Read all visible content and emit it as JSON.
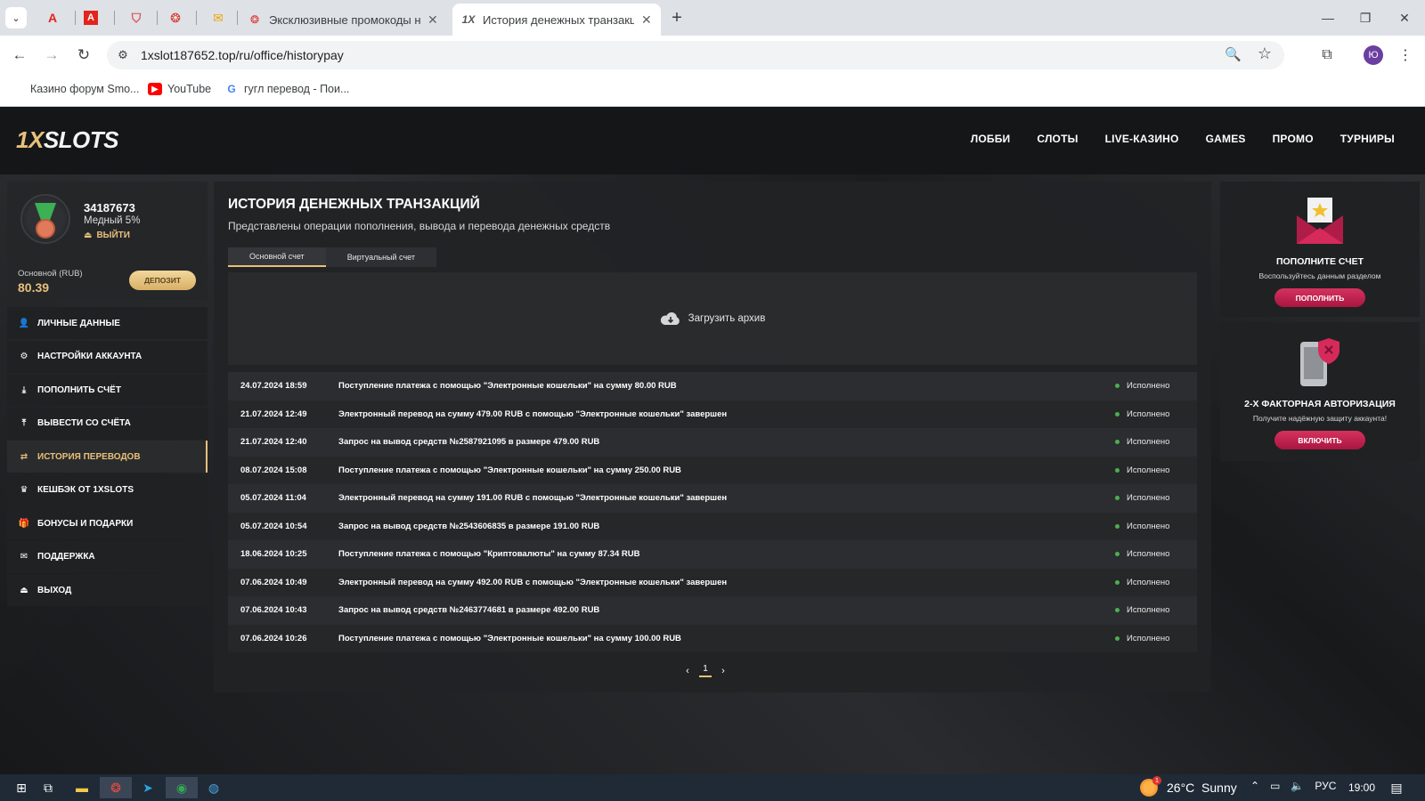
{
  "browser": {
    "pinned_tabs": [
      {
        "icon": "acrobat-icon",
        "glyph": "A",
        "color": "#e1251b"
      },
      {
        "icon": "pdf-icon",
        "glyph": "A",
        "color": "#e1251b"
      },
      {
        "icon": "shield-icon",
        "glyph": "⛉",
        "color": "#d9534f"
      },
      {
        "icon": "casino-icon",
        "glyph": "❂",
        "color": "#d9342b"
      },
      {
        "icon": "mail-icon",
        "glyph": "✉",
        "color": "#f0a500"
      }
    ],
    "tabs": [
      {
        "title": "Эксклюзивные промокоды на",
        "active": false
      },
      {
        "title": "История денежных транзакци",
        "active": true
      }
    ],
    "url": "1xslot187652.top/ru/office/historypay",
    "profile_initial": "Ю",
    "bookmarks": [
      {
        "label": "Казино форум Smo..."
      },
      {
        "label": "YouTube"
      },
      {
        "label": "гугл перевод - Пои..."
      }
    ]
  },
  "site": {
    "logo": {
      "accent": "1X",
      "rest": "SLOTS"
    },
    "nav": [
      "ЛОББИ",
      "СЛОТЫ",
      "LIVE-КАЗИНО",
      "GAMES",
      "ПРОМО",
      "ТУРНИРЫ"
    ],
    "user": {
      "id": "34187673",
      "rank": "Медный 5%",
      "logout": "ВЫЙТИ",
      "balance_label": "Основной (RUB)",
      "balance": "80.39",
      "deposit_label": "ДЕПОЗИТ"
    },
    "side_menu": [
      {
        "label": "ЛИЧНЫЕ ДАННЫЕ",
        "icon": "user-icon",
        "glyph": "👤",
        "active": false
      },
      {
        "label": "НАСТРОЙКИ АККАУНТА",
        "icon": "settings-icon",
        "glyph": "⚙",
        "active": false
      },
      {
        "label": "ПОПОЛНИТЬ СЧЁТ",
        "icon": "download-icon",
        "glyph": "⤓",
        "active": false
      },
      {
        "label": "ВЫВЕСТИ СО СЧЁТА",
        "icon": "withdraw-icon",
        "glyph": "⤒",
        "active": false
      },
      {
        "label": "ИСТОРИЯ ПЕРЕВОДОВ",
        "icon": "transfer-icon",
        "glyph": "⇄",
        "active": true
      },
      {
        "label": "КЕШБЭК ОТ 1XSLOTS",
        "icon": "crown-icon",
        "glyph": "♛",
        "active": false
      },
      {
        "label": "БОНУСЫ И ПОДАРКИ",
        "icon": "gift-icon",
        "glyph": "🎁",
        "active": false
      },
      {
        "label": "ПОДДЕРЖКА",
        "icon": "envelope-icon",
        "glyph": "✉",
        "active": false
      },
      {
        "label": "ВЫХОД",
        "icon": "exit-icon",
        "glyph": "⏏",
        "active": false
      }
    ],
    "main": {
      "title": "ИСТОРИЯ ДЕНЕЖНЫХ ТРАНЗАКЦИЙ",
      "subtitle": "Представлены операции пополнения, вывода и перевода денежных средств",
      "tabs": [
        {
          "label": "Основной счет",
          "active": true
        },
        {
          "label": "Виртуальный счет",
          "active": false
        }
      ],
      "archive_label": "Загрузить архив",
      "transactions": [
        {
          "date": "24.07.2024 18:59",
          "desc": "Поступление платежа с помощью \"Электронные кошельки\" на сумму 80.00 RUB",
          "status": "Исполнено"
        },
        {
          "date": "21.07.2024 12:49",
          "desc": "Электронный перевод на сумму 479.00 RUB с помощью \"Электронные кошельки\" завершен",
          "status": "Исполнено"
        },
        {
          "date": "21.07.2024 12:40",
          "desc": "Запрос на вывод средств №2587921095 в размере 479.00 RUB",
          "status": "Исполнено"
        },
        {
          "date": "08.07.2024 15:08",
          "desc": "Поступление платежа с помощью \"Электронные кошельки\" на сумму 250.00 RUB",
          "status": "Исполнено"
        },
        {
          "date": "05.07.2024 11:04",
          "desc": "Электронный перевод на сумму 191.00 RUB с помощью \"Электронные кошельки\" завершен",
          "status": "Исполнено"
        },
        {
          "date": "05.07.2024 10:54",
          "desc": "Запрос на вывод средств №2543606835 в размере 191.00 RUB",
          "status": "Исполнено"
        },
        {
          "date": "18.06.2024 10:25",
          "desc": "Поступление платежа с помощью \"Криптовалюты\" на сумму 87.34 RUB",
          "status": "Исполнено"
        },
        {
          "date": "07.06.2024 10:49",
          "desc": "Электронный перевод на сумму 492.00 RUB с помощью \"Электронные кошельки\" завершен",
          "status": "Исполнено"
        },
        {
          "date": "07.06.2024 10:43",
          "desc": "Запрос на вывод средств №2463774681 в размере 492.00 RUB",
          "status": "Исполнено"
        },
        {
          "date": "07.06.2024 10:26",
          "desc": "Поступление платежа с помощью \"Электронные кошельки\" на сумму 100.00 RUB",
          "status": "Исполнено"
        }
      ],
      "pager": {
        "prev": "‹",
        "current": "1",
        "next": "›"
      }
    },
    "promo": [
      {
        "title": "ПОПОЛНИТЕ СЧЕТ",
        "text": "Воспользуйтесь данным разделом",
        "button": "ПОПОЛНИТЬ"
      },
      {
        "title": "2-Х ФАКТОРНАЯ АВТОРИЗАЦИЯ",
        "text": "Получите надёжную защиту аккаунта!",
        "button": "ВКЛЮЧИТЬ"
      }
    ],
    "colors": {
      "accent_gold": "#e8c07a",
      "accent_pink": "#c0234f",
      "status_green": "#4caf50"
    }
  },
  "taskbar": {
    "weather": "26°C  Sunny",
    "weather_badge": "1",
    "lang": "РУС",
    "time": "19:00"
  }
}
